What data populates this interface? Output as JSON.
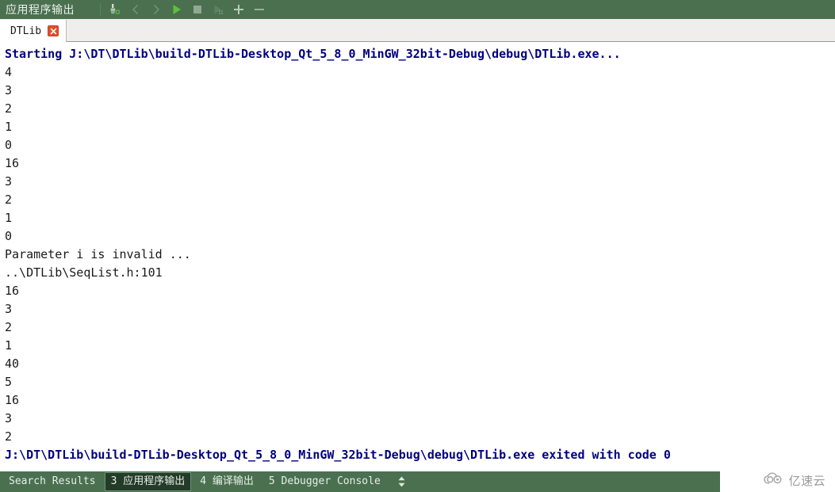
{
  "header": {
    "title": "应用程序输出",
    "toolbar": [
      {
        "name": "clear-pane-icon",
        "label": "Clear"
      },
      {
        "name": "prev-item-icon",
        "label": "Previous Item"
      },
      {
        "name": "next-item-icon",
        "label": "Next Item"
      },
      {
        "name": "run-icon",
        "label": "Run"
      },
      {
        "name": "stop-icon",
        "label": "Stop"
      },
      {
        "name": "rerun-icon",
        "label": "Re-run"
      },
      {
        "name": "zoom-in-icon",
        "label": "Increase Font Size"
      },
      {
        "name": "zoom-out-icon",
        "label": "Decrease Font Size"
      }
    ],
    "colors": {
      "bar": "#4a7050",
      "run_green": "#5fbf3f",
      "stop_gray": "#93a893"
    }
  },
  "tabs": [
    {
      "label": "DTLib",
      "close_label": "×",
      "active": true
    }
  ],
  "output": {
    "lines": [
      {
        "text": "Starting J:\\DT\\DTLib\\build-DTLib-Desktop_Qt_5_8_0_MinGW_32bit-Debug\\debug\\DTLib.exe...",
        "style": "msg"
      },
      {
        "text": "4",
        "style": "normal"
      },
      {
        "text": "3",
        "style": "normal"
      },
      {
        "text": "2",
        "style": "normal"
      },
      {
        "text": "1",
        "style": "normal"
      },
      {
        "text": "0",
        "style": "normal"
      },
      {
        "text": "16",
        "style": "normal"
      },
      {
        "text": "3",
        "style": "normal"
      },
      {
        "text": "2",
        "style": "normal"
      },
      {
        "text": "1",
        "style": "normal"
      },
      {
        "text": "0",
        "style": "normal"
      },
      {
        "text": "Parameter i is invalid ...",
        "style": "normal"
      },
      {
        "text": "..\\DTLib\\SeqList.h:101",
        "style": "normal"
      },
      {
        "text": "16",
        "style": "normal"
      },
      {
        "text": "3",
        "style": "normal"
      },
      {
        "text": "2",
        "style": "normal"
      },
      {
        "text": "1",
        "style": "normal"
      },
      {
        "text": "40",
        "style": "normal"
      },
      {
        "text": "5",
        "style": "normal"
      },
      {
        "text": "16",
        "style": "normal"
      },
      {
        "text": "3",
        "style": "normal"
      },
      {
        "text": "2",
        "style": "normal"
      },
      {
        "text": "J:\\DT\\DTLib\\build-DTLib-Desktop_Qt_5_8_0_MinGW_32bit-Debug\\debug\\DTLib.exe exited with code 0",
        "style": "msg"
      }
    ],
    "colors": {
      "message": "#00007f",
      "stdout": "#1a1a1a",
      "background": "#ffffff"
    }
  },
  "status_bar": {
    "items": [
      {
        "label": "Search Results",
        "active": false
      },
      {
        "label": "3 应用程序输出",
        "active": true
      },
      {
        "label": "4 编译输出",
        "active": false
      },
      {
        "label": "5 Debugger Console",
        "active": false
      }
    ],
    "spinner_icon": "up-down-arrow-icon"
  },
  "watermark": {
    "text": "亿速云",
    "logo_icon": "cloud-icon"
  }
}
